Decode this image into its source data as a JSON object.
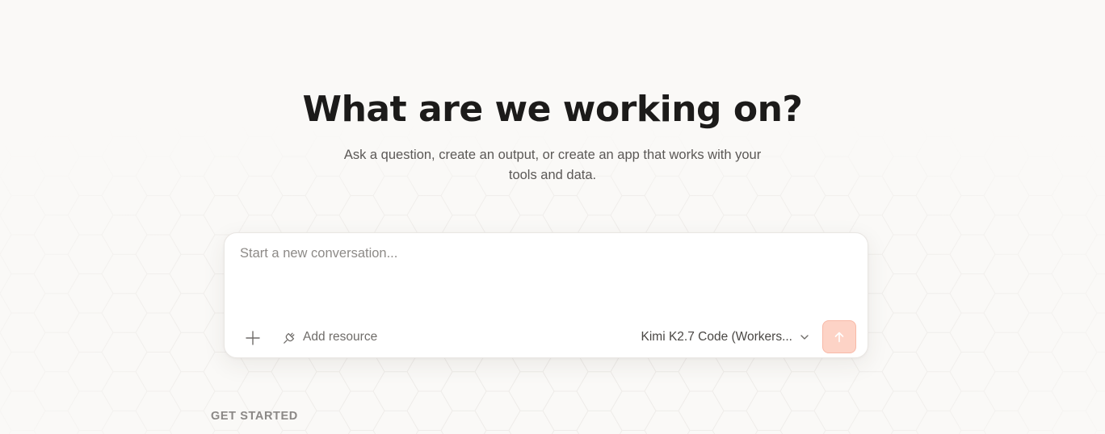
{
  "hero": {
    "title": "What are we working on?",
    "subtitle": "Ask a question, create an output, or create an app that works with your tools and data."
  },
  "composer": {
    "placeholder": "Start a new conversation...",
    "add_resource_label": "Add resource",
    "model_label": "Kimi K2.7 Code (Workers...",
    "icons": {
      "attach": "plus-icon",
      "resource": "plug-icon",
      "dropdown": "chevron-down-icon",
      "send": "arrow-up-icon"
    }
  },
  "get_started": {
    "label": "GET STARTED"
  },
  "colors": {
    "background": "#faf9f7",
    "send_button": "#fdd3c6",
    "send_button_border": "#f8b9a7"
  }
}
